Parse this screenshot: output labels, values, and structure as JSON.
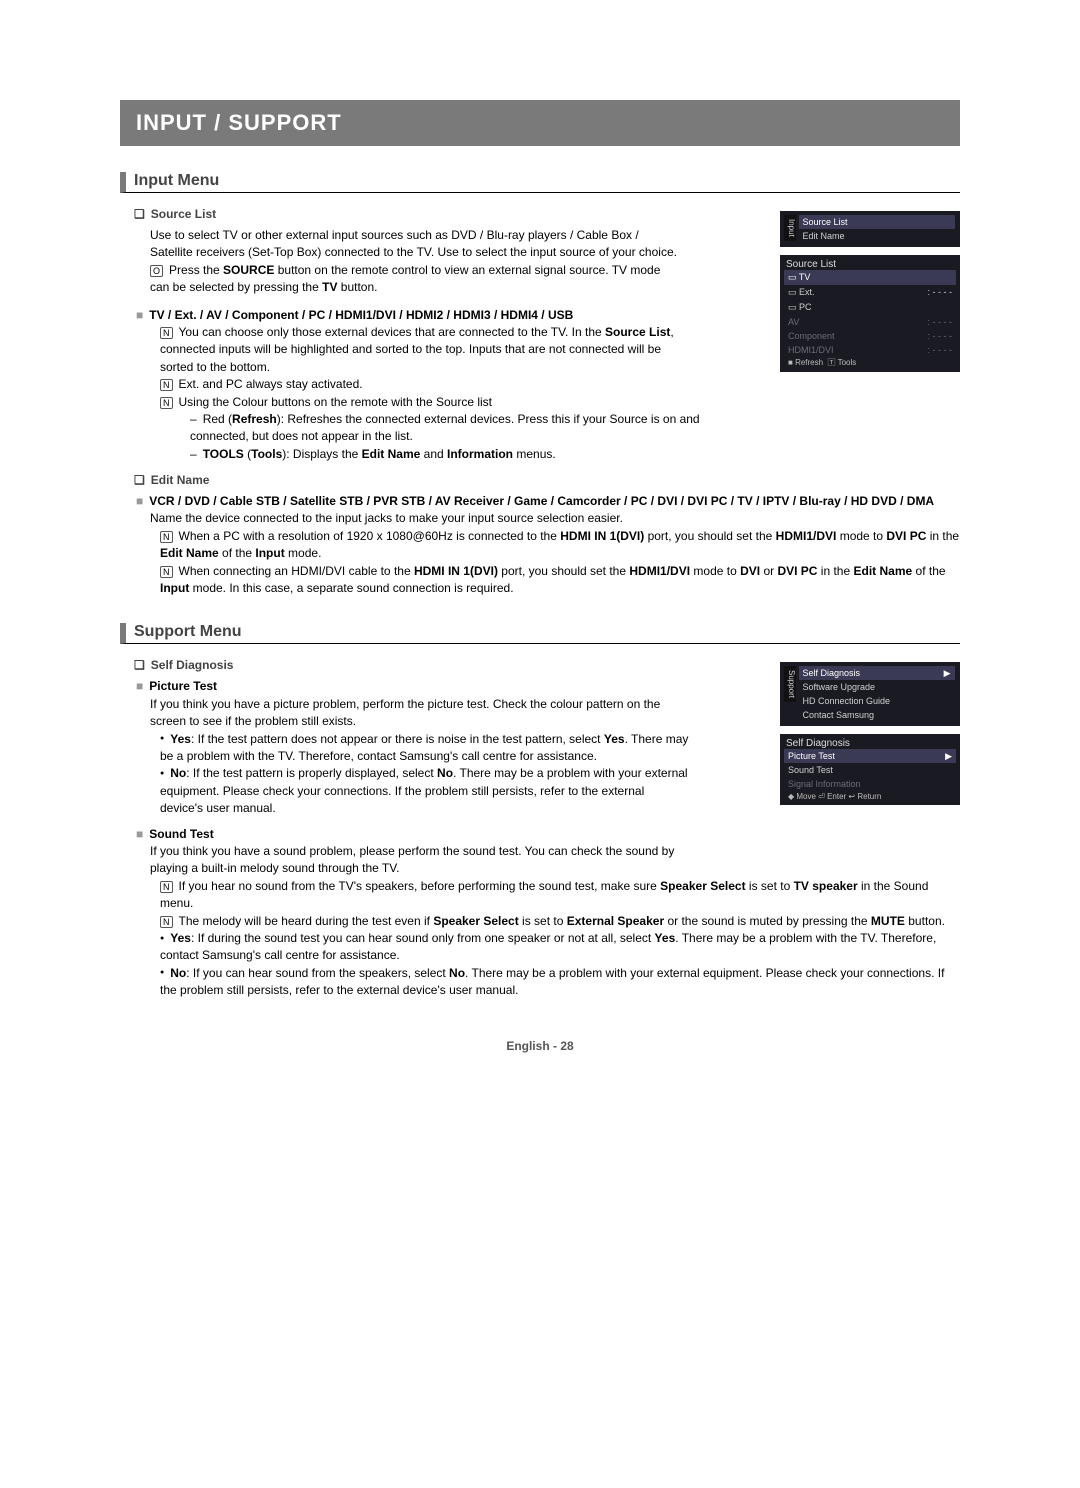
{
  "banner": "INPUT / SUPPORT",
  "section_input": "Input Menu",
  "source_list": {
    "heading": "Source List",
    "body": "Use to select TV or other external input sources such as DVD / Blu-ray players / Cable Box / Satellite receivers (Set-Top Box) connected to the TV. Use to select the input source of your choice.",
    "press_note": "Press the SOURCE button on the remote control to view an external signal source. TV mode can be selected by pressing the TV button."
  },
  "tv_ext": {
    "heading": "TV / Ext. / AV / Component / PC / HDMI1/DVI / HDMI2 / HDMI3 / HDMI4 / USB",
    "note1": "You can choose only those external devices that are connected to the TV. In the Source List, connected inputs will be highlighted and sorted to the top. Inputs that are not connected will be sorted to the bottom.",
    "note2": "Ext. and PC always stay activated.",
    "note3": "Using the Colour buttons on the remote with the Source list",
    "red": "Red (Refresh): Refreshes the connected external devices. Press this if your Source is on and connected, but does not appear in the list.",
    "tools": "TOOLS (Tools): Displays the Edit Name and Information menus."
  },
  "edit_name": {
    "heading": "Edit Name",
    "devices": "VCR / DVD / Cable STB / Satellite STB / PVR STB / AV Receiver / Game / Camcorder / PC / DVI / DVI PC / TV / IPTV / Blu-ray / HD DVD / DMA",
    "body": "Name the device connected to the input jacks to make your input source selection easier.",
    "note1": "When a PC with a resolution of 1920 x 1080@60Hz is connected to the HDMI IN 1(DVI) port, you should set the HDMI1/DVI mode to DVI PC in the Edit Name of the Input mode.",
    "note2": "When connecting an HDMI/DVI cable to the HDMI IN 1(DVI) port, you should set the HDMI1/DVI mode to DVI or DVI PC in the Edit Name of the Input mode. In this case, a separate sound connection is required."
  },
  "section_support": "Support Menu",
  "self_diag": {
    "heading": "Self Diagnosis",
    "picture_test_heading": "Picture Test",
    "picture_body": "If you think you have a picture problem, perform the picture test. Check the colour pattern on the screen to see if the problem still exists.",
    "picture_yes": "Yes: If the test pattern does not appear or there is noise in the test pattern, select Yes. There may be a problem with the TV. Therefore, contact Samsung's call centre for assistance.",
    "picture_no": "No: If the test pattern is properly displayed, select No. There may be a problem with your external equipment. Please check your connections. If the problem still persists, refer to the external device's user manual.",
    "sound_test_heading": "Sound Test",
    "sound_body": "If you think you have a sound problem, please perform the sound test. You can check the sound by playing a built-in melody sound through the TV.",
    "sound_note1": "If you hear no sound from the TV's speakers, before performing the sound test, make sure Speaker Select is set to TV speaker in the Sound menu.",
    "sound_note2": "The melody will be heard during the test even if Speaker Select is set to External Speaker or the sound is muted by pressing the MUTE button.",
    "sound_yes": "Yes: If during the sound test you can hear sound only from one speaker or not at all, select Yes. There may be a problem with the TV. Therefore, contact Samsung's call centre for assistance.",
    "sound_no": "No: If you can hear sound from the speakers, select No. There may be a problem with your external equipment. Please check your connections. If the problem still persists, refer to the external device's user manual."
  },
  "osd_input_menu": {
    "side": "Input",
    "items": [
      "Source List",
      "Edit Name"
    ]
  },
  "osd_source_list": {
    "title": "Source List",
    "active": "TV",
    "items_on": [
      "Ext.",
      "PC"
    ],
    "items_off": [
      "AV",
      "Component",
      "HDMI1/DVI"
    ],
    "val": ": - - - -",
    "footer_refresh": "Refresh",
    "footer_tools": "Tools"
  },
  "osd_support_menu": {
    "side": "Support",
    "items": [
      "Self Diagnosis",
      "Software Upgrade",
      "HD Connection Guide",
      "Contact Samsung"
    ]
  },
  "osd_self_diag": {
    "title": "Self Diagnosis",
    "items": [
      "Picture Test",
      "Sound Test",
      "Signal Information"
    ],
    "footer": "◆ Move   ⏎ Enter   ↩ Return"
  },
  "footer": "English - 28"
}
